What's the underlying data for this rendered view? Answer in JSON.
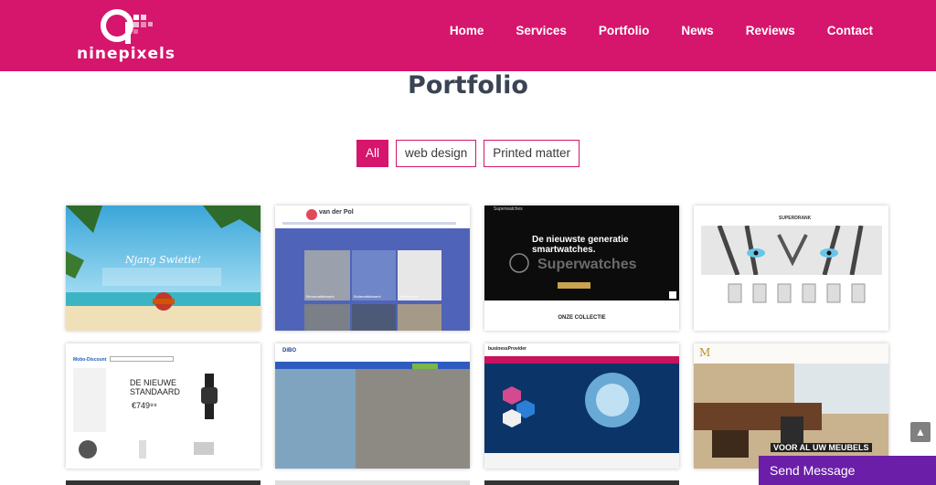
{
  "brand": {
    "name": "ninepixels",
    "color": "#d6156c"
  },
  "nav": [
    {
      "label": "Home"
    },
    {
      "label": "Services"
    },
    {
      "label": "Portfolio"
    },
    {
      "label": "News"
    },
    {
      "label": "Reviews"
    },
    {
      "label": "Contact"
    }
  ],
  "page_title": "Portfolio",
  "filters": [
    {
      "label": "All",
      "active": true
    },
    {
      "label": "web design",
      "active": false
    },
    {
      "label": "Printed matter",
      "active": false
    }
  ],
  "tiles": {
    "t1": {
      "headline": "Njang Swietie!"
    },
    "t2": {
      "brand": "van der Pol",
      "cards": [
        "Binnenafdekwerk",
        "Buitenafdekwerk",
        "Werkkleiger"
      ]
    },
    "t3": {
      "brand": "Superwatches",
      "headline": "De nieuwste generatie smartwatches.",
      "overlay": "Superwatches",
      "section": "ONZE COLLECTIE"
    },
    "t4": {
      "brand": "SUPERDRANK"
    },
    "t5": {
      "brand": "Mobo-Discount",
      "headline": "DE NIEUWE STANDAARD",
      "price": "€749⁹⁹"
    },
    "t6": {
      "brand": "DiBO"
    },
    "t7": {
      "brand": "businessProvider"
    },
    "t8": {
      "banner": "VOOR AL UW MEUBELS"
    }
  },
  "send_message": "Send Message",
  "scroll_top_icon": "arrow-up-icon"
}
